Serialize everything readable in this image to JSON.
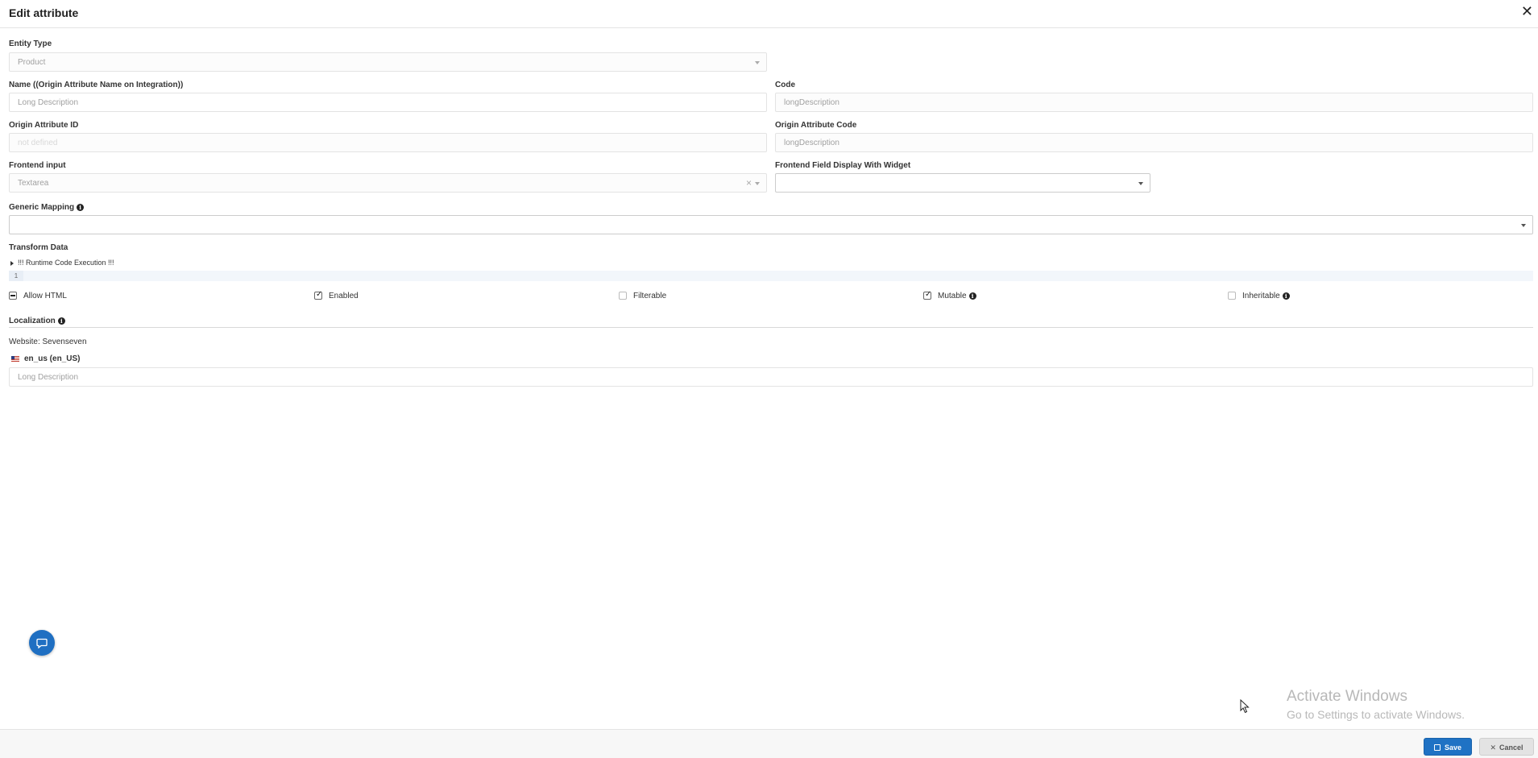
{
  "header": {
    "title": "Edit attribute",
    "close_glyph": "✕"
  },
  "entity_type": {
    "label": "Entity Type",
    "value": "Product"
  },
  "name": {
    "label": "Name ((Origin Attribute Name on Integration))",
    "placeholder": "Long Description"
  },
  "code": {
    "label": "Code",
    "value": "longDescription"
  },
  "origin_id": {
    "label": "Origin Attribute ID",
    "placeholder": "not defined"
  },
  "origin_code": {
    "label": "Origin Attribute Code",
    "value": "longDescription"
  },
  "frontend_input": {
    "label": "Frontend input",
    "value": "Textarea",
    "clear_glyph": "×"
  },
  "frontend_widget": {
    "label": "Frontend Field Display With Widget",
    "value": ""
  },
  "generic_mapping": {
    "label": "Generic Mapping",
    "value": ""
  },
  "transform": {
    "label": "Transform Data",
    "toggle_label": "!!! Runtime Code Execution !!!",
    "line_number": "1"
  },
  "options": [
    {
      "label": "Allow HTML",
      "state": "indeterminate",
      "info": false
    },
    {
      "label": "Enabled",
      "state": "checked",
      "info": false
    },
    {
      "label": "Filterable",
      "state": "unchecked",
      "info": false
    },
    {
      "label": "Mutable",
      "state": "checked",
      "info": true
    },
    {
      "label": "Inheritable",
      "state": "unchecked",
      "info": true
    }
  ],
  "localization": {
    "label": "Localization",
    "website": "Website: Sevenseven",
    "locale": "en_us (en_US)",
    "placeholder": "Long Description"
  },
  "info_glyph": "i",
  "check_glyph": "✓",
  "watermark": {
    "line1": "Activate Windows",
    "line2": "Go to Settings to activate Windows."
  },
  "footer": {
    "save_label": "Save",
    "cancel_label": "Cancel"
  },
  "colors": {
    "primary": "#1f72c4",
    "chat": "#1f6fc2"
  }
}
